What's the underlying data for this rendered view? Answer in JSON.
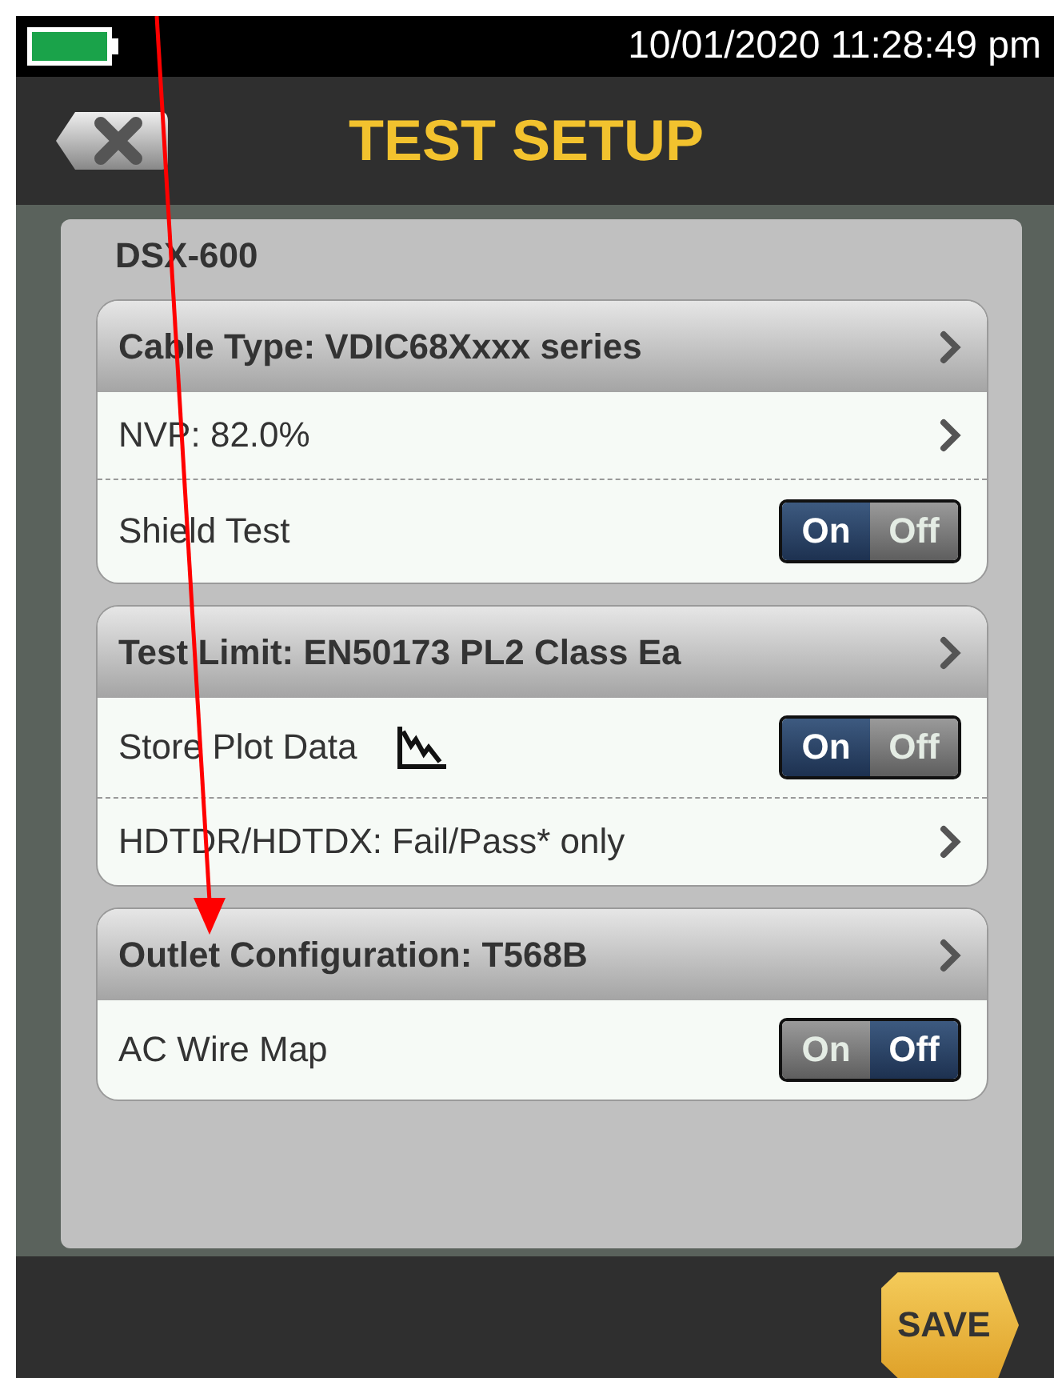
{
  "status_bar": {
    "datetime": "10/01/2020 11:28:49 pm"
  },
  "header": {
    "title": "TEST SETUP"
  },
  "panel": {
    "title": "DSX-600"
  },
  "cards": [
    {
      "header": "Cable Type: VDIC68Xxxx series",
      "rows": [
        {
          "kind": "link",
          "label": "NVP: 82.0%"
        },
        {
          "kind": "toggle",
          "label": "Shield Test",
          "on": true,
          "on_label": "On",
          "off_label": "Off"
        }
      ]
    },
    {
      "header": "Test Limit: EN50173 PL2 Class Ea",
      "rows": [
        {
          "kind": "plot-toggle",
          "label": "Store Plot Data",
          "on": true,
          "on_label": "On",
          "off_label": "Off"
        },
        {
          "kind": "link",
          "label": "HDTDR/HDTDX: Fail/Pass* only"
        }
      ]
    },
    {
      "header": "Outlet Configuration: T568B",
      "rows": [
        {
          "kind": "toggle",
          "label": "AC Wire Map",
          "on": false,
          "on_label": "On",
          "off_label": "Off"
        }
      ]
    }
  ],
  "footer": {
    "save_label": "SAVE"
  }
}
